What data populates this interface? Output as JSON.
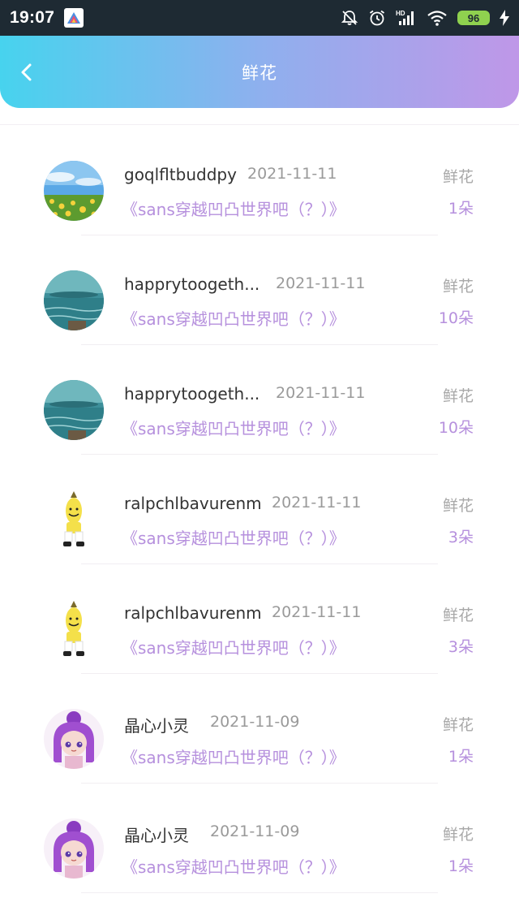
{
  "status_bar": {
    "time": "19:07",
    "battery": "96",
    "network": "HD"
  },
  "header": {
    "title": "鲜花",
    "back_icon": "chevron-left-icon"
  },
  "colors": {
    "header_gradient_start": "#47d3ee",
    "header_gradient_end": "#bf97e8",
    "accent": "#b690dd"
  },
  "gifts": [
    {
      "name": "goqlfltbuddpy",
      "date": "2021-11-11",
      "work_title": "《sans穿越凹凸世界吧（？）》",
      "gift_type": "鲜花",
      "count": "1朵",
      "avatar": "field-flowers"
    },
    {
      "name": "happrytoogeth...",
      "date": "2021-11-11",
      "work_title": "《sans穿越凹凸世界吧（？）》",
      "gift_type": "鲜花",
      "count": "10朵",
      "avatar": "sea"
    },
    {
      "name": "happrytoogeth...",
      "date": "2021-11-11",
      "work_title": "《sans穿越凹凸世界吧（？）》",
      "gift_type": "鲜花",
      "count": "10朵",
      "avatar": "sea"
    },
    {
      "name": "ralpchlbavurenm",
      "date": "2021-11-11",
      "work_title": "《sans穿越凹凸世界吧（？）》",
      "gift_type": "鲜花",
      "count": "3朵",
      "avatar": "banana-man"
    },
    {
      "name": "ralpchlbavurenm",
      "date": "2021-11-11",
      "work_title": "《sans穿越凹凸世界吧（？）》",
      "gift_type": "鲜花",
      "count": "3朵",
      "avatar": "banana-man"
    },
    {
      "name": "晶心小灵",
      "date": "2021-11-09",
      "work_title": "《sans穿越凹凸世界吧（？）》",
      "gift_type": "鲜花",
      "count": "1朵",
      "avatar": "anime-girl"
    },
    {
      "name": "晶心小灵",
      "date": "2021-11-09",
      "work_title": "《sans穿越凹凸世界吧（？）》",
      "gift_type": "鲜花",
      "count": "1朵",
      "avatar": "anime-girl"
    }
  ]
}
